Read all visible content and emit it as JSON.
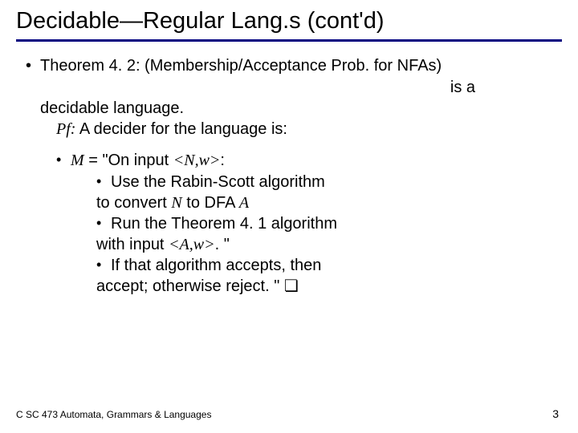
{
  "title": "Decidable—Regular Lang.s (cont'd)",
  "theorem": {
    "label": "Theorem 4. 2: (Membership/Acceptance Prob. for NFAs)",
    "fragment_right": "is a",
    "line2": "decidable language.",
    "proof_intro": "Pf:  A decider for the language is:"
  },
  "machine": {
    "intro_prefix": "M",
    "intro_text": " = \"On input ",
    "intro_input": "<N,w>",
    "intro_suffix": ":",
    "step1a": "Use the Rabin-Scott algorithm",
    "step1b_prefix": "to convert ",
    "step1b_N": "N",
    "step1b_mid": " to DFA ",
    "step1b_A": "A",
    "step2a": "Run the Theorem 4. 1 algorithm",
    "step2b_prefix": "with input  ",
    "step2b_input": "<A,w>",
    "step2b_suffix": ". \"",
    "step3a": "If that algorithm accepts, then",
    "step3b": "accept; otherwise reject. \"  ❏"
  },
  "footer": "C SC 473 Automata, Grammars & Languages",
  "page": "3"
}
